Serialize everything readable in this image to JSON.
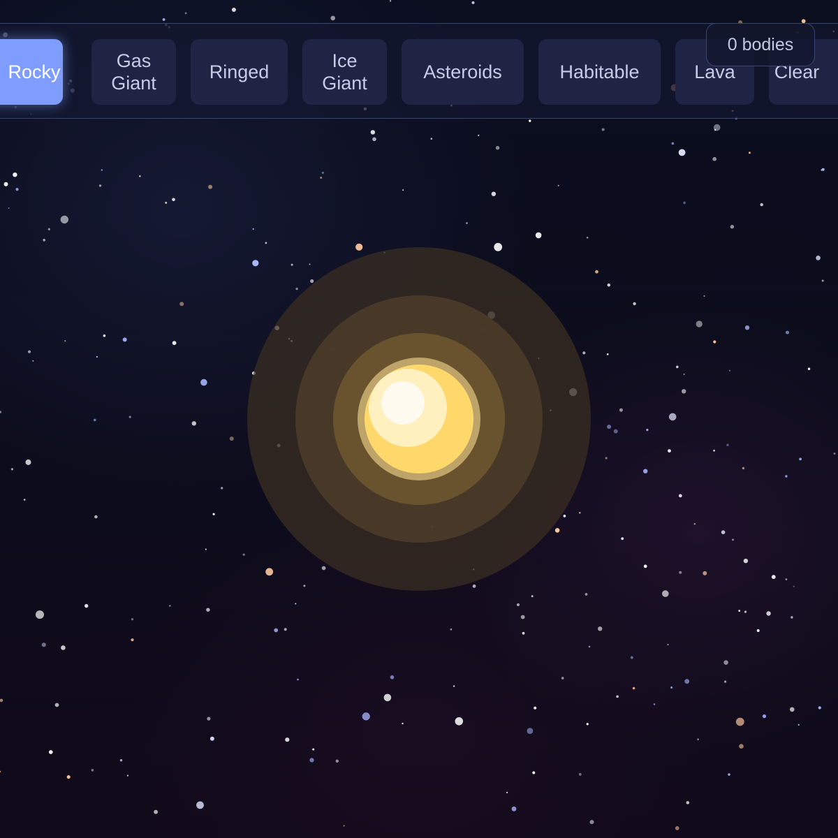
{
  "toolbar": {
    "buttons": [
      {
        "label": "Rocky",
        "active": true
      },
      {
        "label": "Gas\nGiant",
        "active": false
      },
      {
        "label": "Ringed",
        "active": false
      },
      {
        "label": "Ice\nGiant",
        "active": false
      },
      {
        "label": "Asteroids",
        "active": false
      },
      {
        "label": "Habitable",
        "active": false
      },
      {
        "label": "Lava",
        "active": false
      },
      {
        "label": "Clear",
        "active": false
      }
    ]
  },
  "counter": {
    "text": "0 bodies"
  },
  "colors": {
    "accent": "#7f9dff",
    "button_bg": "#1f2445",
    "sun_core": "#ffd86b",
    "sun_glow": "#fff6d6"
  }
}
